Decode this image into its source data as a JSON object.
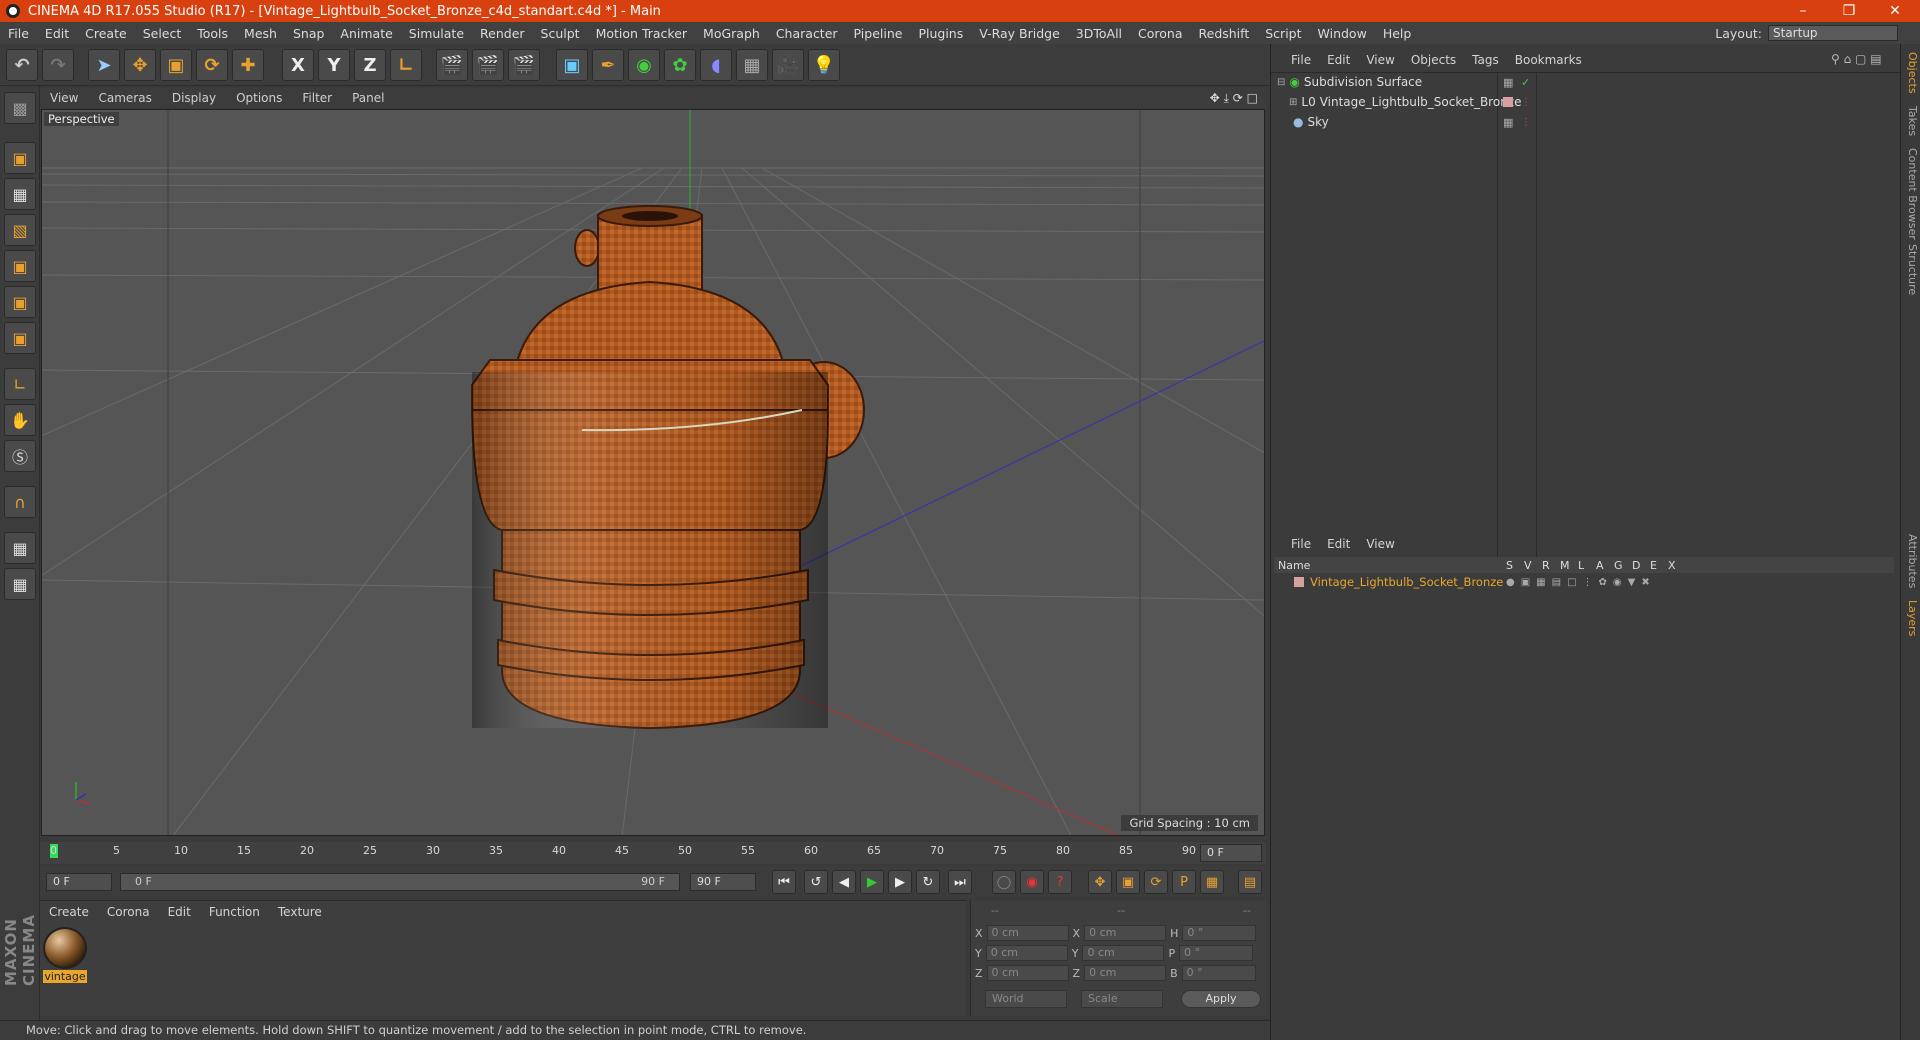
{
  "window": {
    "title": "CINEMA 4D R17.055 Studio (R17) - [Vintage_Lightbulb_Socket_Bronze_c4d_standart.c4d *] - Main"
  },
  "menu": [
    "File",
    "Edit",
    "Create",
    "Select",
    "Tools",
    "Mesh",
    "Snap",
    "Animate",
    "Simulate",
    "Render",
    "Sculpt",
    "Motion Tracker",
    "MoGraph",
    "Character",
    "Pipeline",
    "Plugins",
    "V-Ray Bridge",
    "3DToAll",
    "Corona",
    "Redshift",
    "Script",
    "Window",
    "Help"
  ],
  "layout": {
    "label": "Layout:",
    "value": "Startup"
  },
  "toolbar": {
    "axis_x": "X",
    "axis_y": "Y",
    "axis_z": "Z"
  },
  "viewport": {
    "menu": [
      "View",
      "Cameras",
      "Display",
      "Options",
      "Filter",
      "Panel"
    ],
    "label": "Perspective",
    "grid_spacing": "Grid Spacing : 10 cm"
  },
  "timeline": {
    "ticks": [
      "0",
      "5",
      "10",
      "15",
      "20",
      "25",
      "30",
      "35",
      "40",
      "45",
      "50",
      "55",
      "60",
      "65",
      "70",
      "75",
      "80",
      "85",
      "90"
    ],
    "current_frame": "0 F"
  },
  "transport": {
    "start": "0 F",
    "range_start": "0 F",
    "range_end": "90 F",
    "end": "90 F"
  },
  "material_panel": {
    "menu": [
      "Create",
      "Corona",
      "Edit",
      "Function",
      "Texture"
    ],
    "material_name": "vintage"
  },
  "coords": {
    "headers": [
      "--",
      "--",
      "--"
    ],
    "rows": [
      {
        "a": "X",
        "av": "0 cm",
        "b": "X",
        "bv": "0 cm",
        "c": "H",
        "cv": "0 °"
      },
      {
        "a": "Y",
        "av": "0 cm",
        "b": "Y",
        "bv": "0 cm",
        "c": "P",
        "cv": "0 °"
      },
      {
        "a": "Z",
        "av": "0 cm",
        "b": "Z",
        "bv": "0 cm",
        "c": "B",
        "cv": "0 °"
      }
    ],
    "mode1": "World",
    "mode2": "Scale",
    "apply": "Apply"
  },
  "status": "Move: Click and drag to move elements. Hold down SHIFT to quantize movement / add to the selection in point mode, CTRL to remove.",
  "objects_panel": {
    "menu": [
      "File",
      "Edit",
      "View",
      "Objects",
      "Tags",
      "Bookmarks"
    ],
    "items": [
      "Subdivision Surface",
      "Vintage_Lightbulb_Socket_Bronze",
      "Sky"
    ]
  },
  "layers_panel": {
    "menu": [
      "File",
      "Edit",
      "View"
    ],
    "header": {
      "name": "Name",
      "cols": [
        "S",
        "V",
        "R",
        "M",
        "L",
        "A",
        "G",
        "D",
        "E",
        "X"
      ]
    },
    "layer_name": "Vintage_Lightbulb_Socket_Bronze"
  },
  "side_tabs": [
    "Objects",
    "Takes",
    "Content Browser",
    "Structure",
    "Attributes",
    "Layers"
  ],
  "maxon_logo": "MAXON CINEMA 4D",
  "colors": {
    "titlebar": "#d9400f",
    "accent": "#e8a030",
    "layer": "#e8a72c"
  }
}
